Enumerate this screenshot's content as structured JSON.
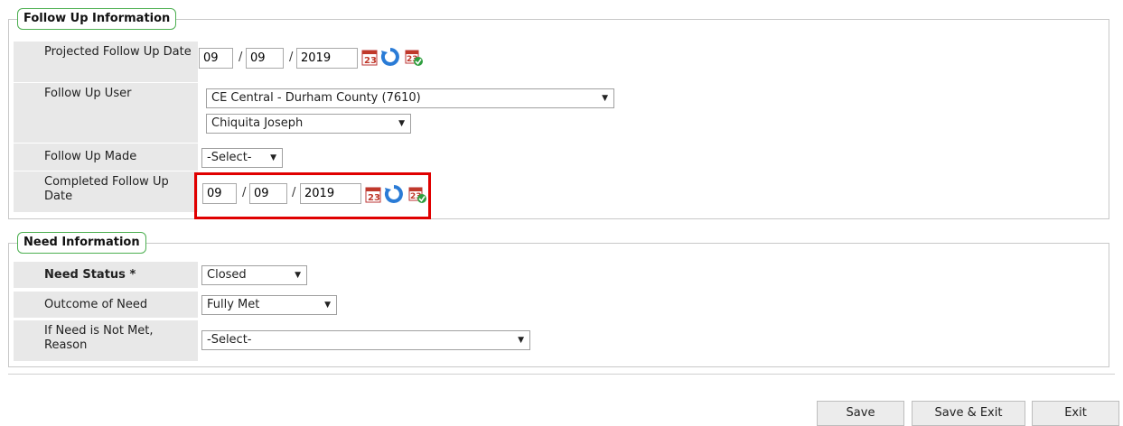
{
  "follow_up": {
    "legend": "Follow Up Information",
    "projected": {
      "label": "Projected Follow Up Date",
      "month": "09",
      "day": "09",
      "year": "2019"
    },
    "user": {
      "label": "Follow Up User",
      "agency": "CE Central - Durham County (7610)",
      "person": "Chiquita Joseph"
    },
    "made": {
      "label": "Follow Up Made",
      "value": "-Select-"
    },
    "completed": {
      "label": "Completed Follow Up Date",
      "month": "09",
      "day": "09",
      "year": "2019"
    }
  },
  "need": {
    "legend": "Need Information",
    "status": {
      "label": "Need Status",
      "required": "*",
      "value": "Closed"
    },
    "outcome": {
      "label": "Outcome of Need",
      "value": "Fully Met"
    },
    "reason": {
      "label": "If Need is Not Met, Reason",
      "value": "-Select-"
    }
  },
  "buttons": {
    "save": "Save",
    "save_exit": "Save & Exit",
    "exit": "Exit"
  },
  "colors": {
    "legend_border": "#4caf50",
    "highlight": "#e00000",
    "label_bg": "#e8e8e8"
  },
  "icons": [
    "calendar-icon",
    "refresh-icon",
    "calendar-check-icon"
  ]
}
